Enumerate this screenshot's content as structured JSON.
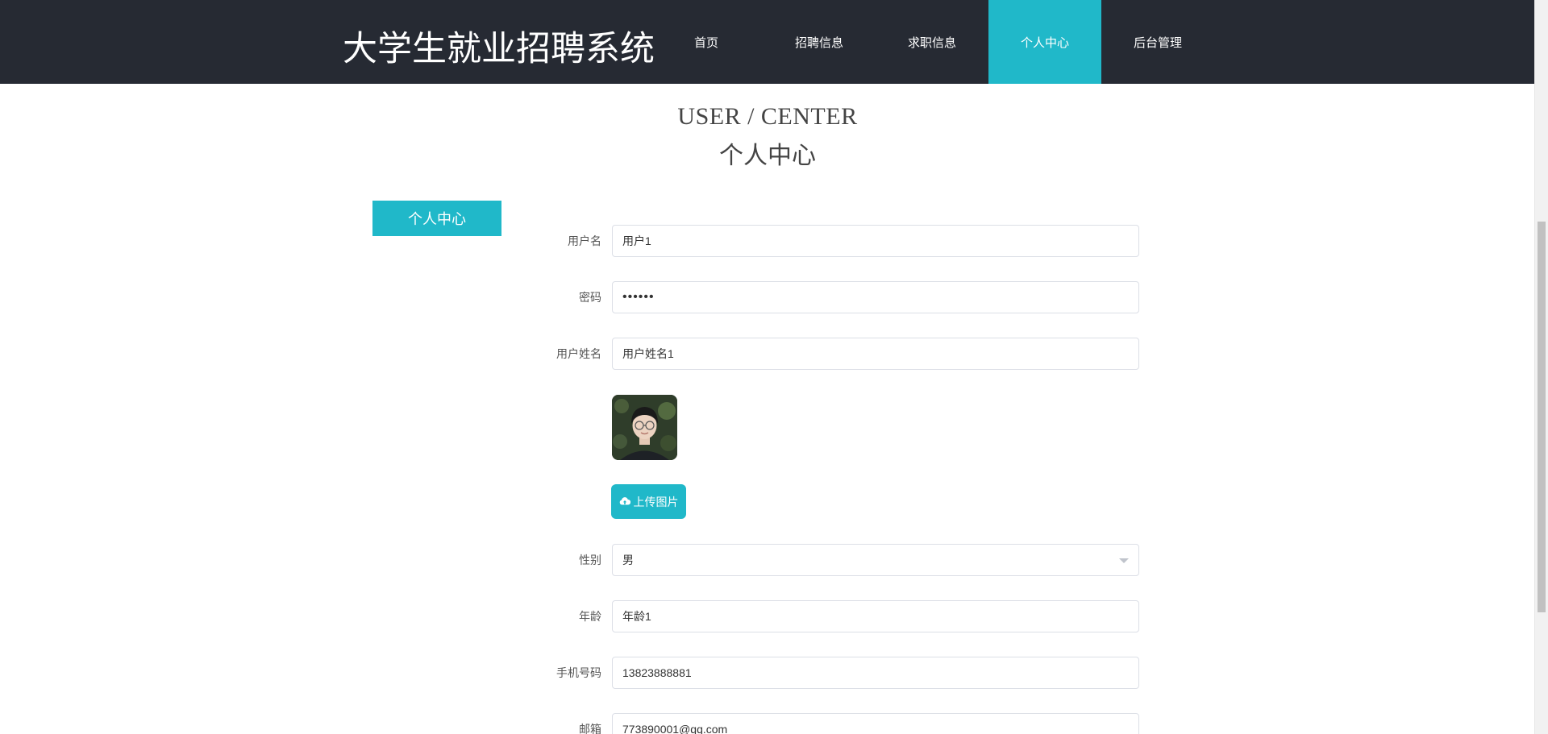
{
  "header": {
    "brand": "大学生就业招聘系统",
    "nav": [
      {
        "label": "首页",
        "active": false
      },
      {
        "label": "招聘信息",
        "active": false
      },
      {
        "label": "求职信息",
        "active": false
      },
      {
        "label": "个人中心",
        "active": true
      },
      {
        "label": "后台管理",
        "active": false
      }
    ]
  },
  "page": {
    "title_en": "USER / CENTER",
    "title_cn": "个人中心"
  },
  "sidebar": {
    "tab_label": "个人中心"
  },
  "form": {
    "username": {
      "label": "用户名",
      "value": "用户1"
    },
    "password": {
      "label": "密码",
      "value": "••••••"
    },
    "fullname": {
      "label": "用户姓名",
      "value": "用户姓名1"
    },
    "upload_label": "上传图片",
    "gender": {
      "label": "性别",
      "value": "男"
    },
    "age": {
      "label": "年龄",
      "value": "年龄1"
    },
    "phone": {
      "label": "手机号码",
      "value": "13823888881"
    },
    "email": {
      "label": "邮箱",
      "value": "773890001@qq.com"
    }
  },
  "colors": {
    "accent": "#20b8c9",
    "header_bg": "#262a33"
  }
}
